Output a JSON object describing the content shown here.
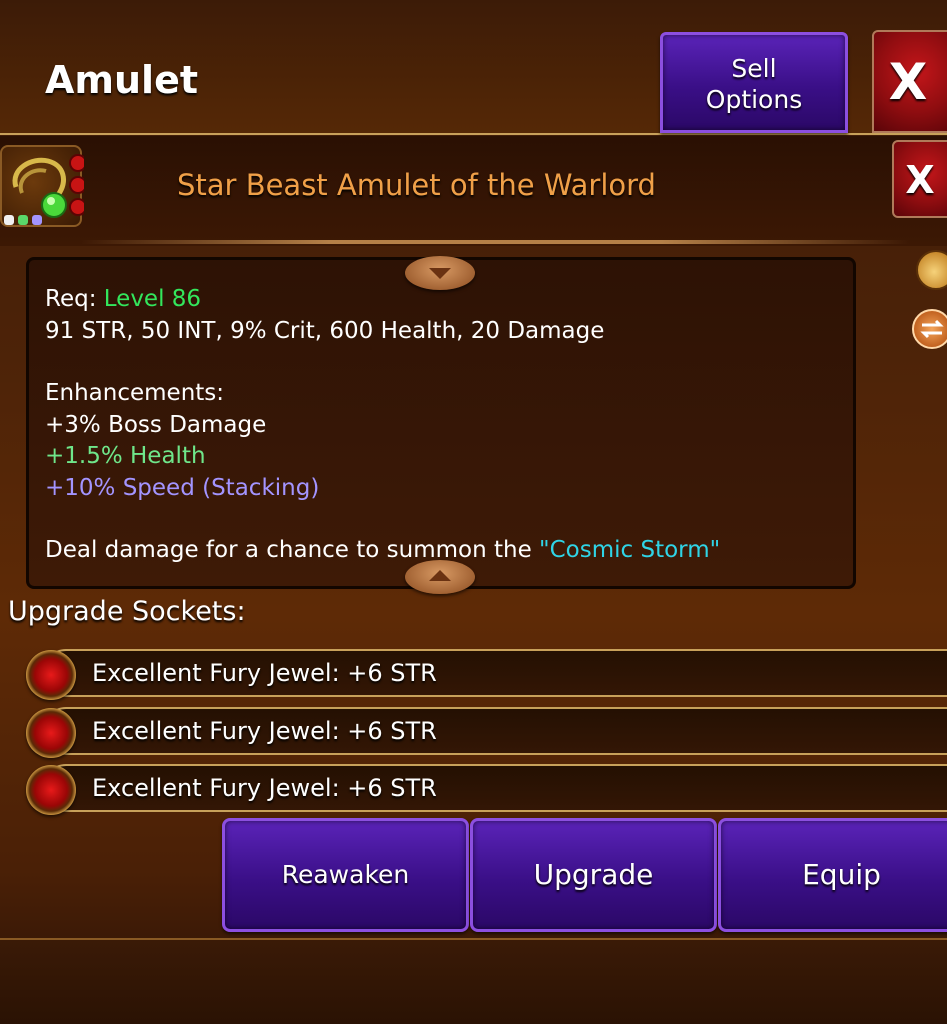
{
  "header": {
    "title": "Amulet",
    "sell_options_line1": "Sell",
    "sell_options_line2": "Options",
    "close_label": "X"
  },
  "item": {
    "name": "Star Beast Amulet of the Warlord",
    "close_label": "X",
    "icon": "amulet-icon"
  },
  "description": {
    "req_label": "Req:",
    "req_value": "Level 86",
    "stats": "91 STR, 50 INT, 9% Crit, 600 Health, 20 Damage",
    "enhancements_label": "Enhancements:",
    "enhancements": [
      {
        "text": "+3% Boss Damage",
        "color": "#ffffff"
      },
      {
        "text": "+1.5% Health",
        "color": "#6fe68a"
      },
      {
        "text": "+10% Speed (Stacking)",
        "color": "#a394ff"
      }
    ],
    "effect_prefix": "Deal damage for a chance to summon the ",
    "effect_highlight": "\"Cosmic Storm\""
  },
  "side_icons": [
    "money-bag-icon",
    "swap-icon"
  ],
  "sockets": {
    "label": "Upgrade Sockets:",
    "items": [
      {
        "text": "Excellent Fury Jewel: +6 STR",
        "gem": "red-jewel-icon"
      },
      {
        "text": "Excellent Fury Jewel: +6 STR",
        "gem": "red-jewel-icon"
      },
      {
        "text": "Excellent Fury Jewel: +6 STR",
        "gem": "red-jewel-icon"
      }
    ]
  },
  "actions": {
    "reawaken": "Reawaken",
    "upgrade": "Upgrade",
    "equip": "Equip"
  },
  "colors": {
    "title_orange": "#f0a048",
    "level_green": "#33e65c",
    "button_purple": "#3a0f87",
    "close_red": "#8f0d10",
    "highlight_cyan": "#2fd4e6"
  }
}
